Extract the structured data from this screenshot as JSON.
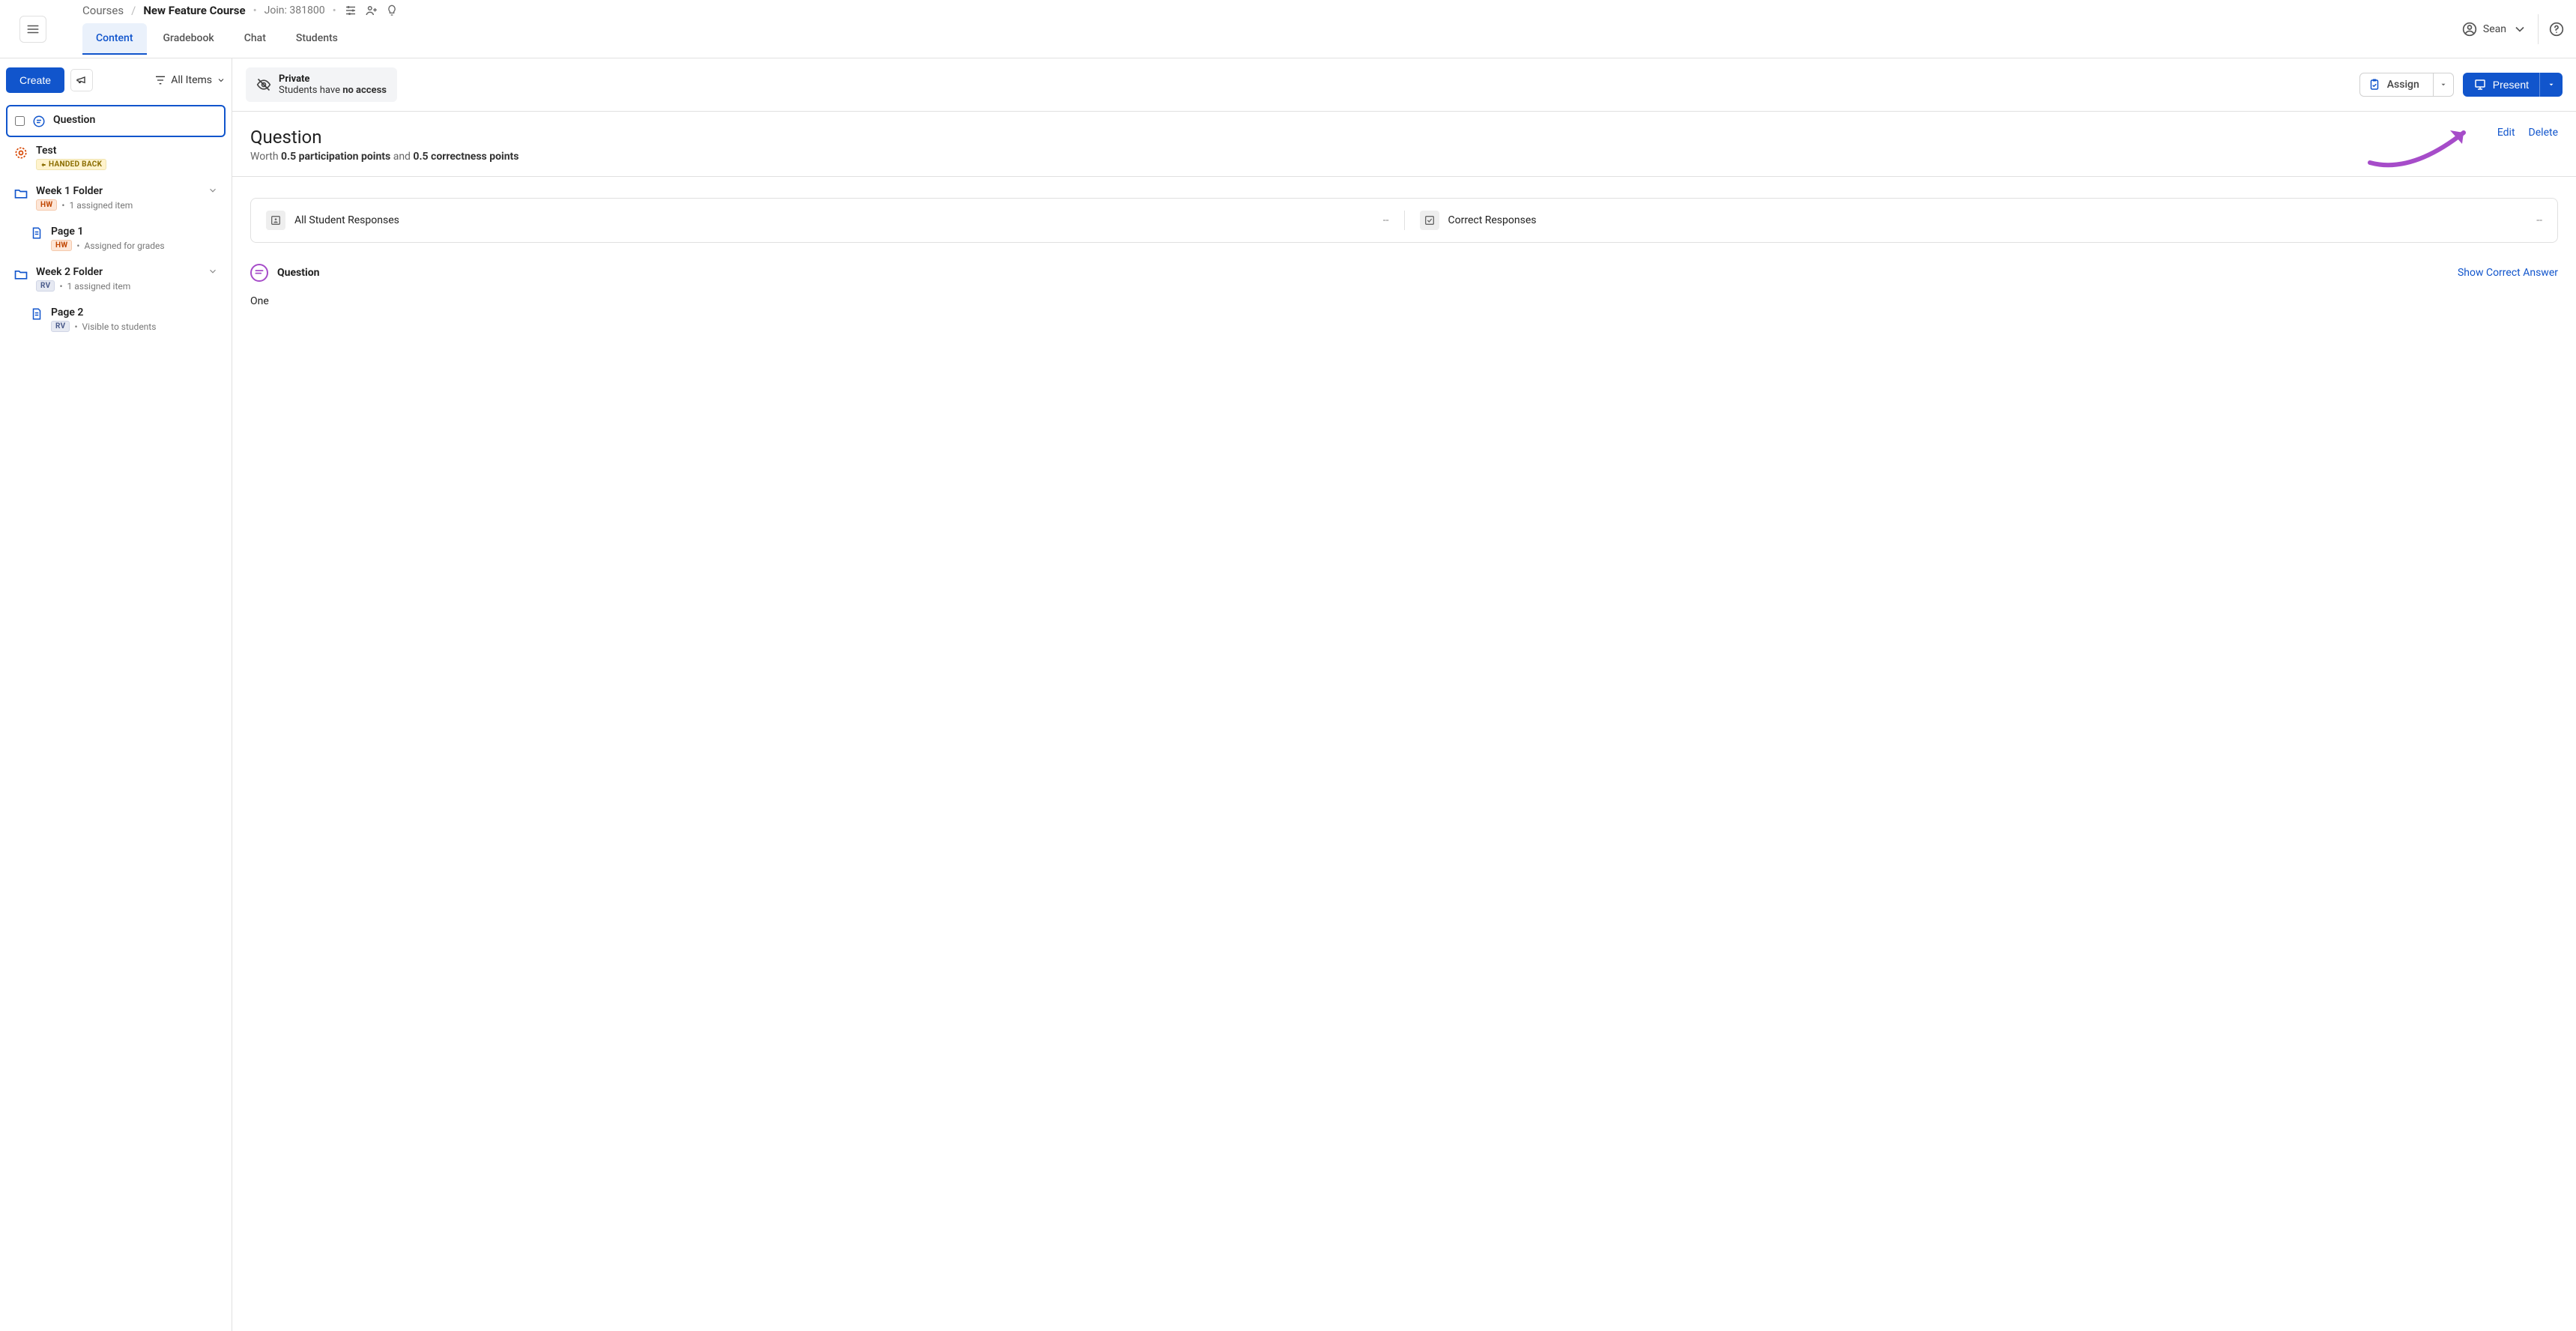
{
  "breadcrumb": {
    "root": "Courses",
    "course": "New Feature Course",
    "join_label": "Join: 381800"
  },
  "tabs": {
    "content": "Content",
    "gradebook": "Gradebook",
    "chat": "Chat",
    "students": "Students"
  },
  "user": {
    "name": "Sean"
  },
  "sidebar": {
    "create_label": "Create",
    "filter_label": "All Items",
    "items": [
      {
        "title": "Question"
      },
      {
        "title": "Test",
        "badge": "HANDED BACK"
      },
      {
        "title": "Week 1 Folder",
        "badge": "HW",
        "meta": "1 assigned item"
      },
      {
        "title": "Page 1",
        "badge": "HW",
        "meta": "Assigned for grades"
      },
      {
        "title": "Week 2 Folder",
        "badge": "RV",
        "meta": "1 assigned item"
      },
      {
        "title": "Page 2",
        "badge": "RV",
        "meta": "Visible to students"
      }
    ]
  },
  "privacy": {
    "title": "Private",
    "sub_prefix": "Students have ",
    "sub_bold": "no access"
  },
  "actions": {
    "assign": "Assign",
    "present": "Present",
    "edit": "Edit",
    "delete": "Delete"
  },
  "question": {
    "title": "Question",
    "worth_prefix": "Worth ",
    "participation": "0.5 participation points",
    "and": " and ",
    "correctness": "0.5 correctness points"
  },
  "responses": {
    "all_label": "All Student Responses",
    "all_value": "--",
    "correct_label": "Correct Responses",
    "correct_value": "--"
  },
  "q_block": {
    "label": "Question",
    "show_link": "Show Correct Answer",
    "body": "One"
  }
}
